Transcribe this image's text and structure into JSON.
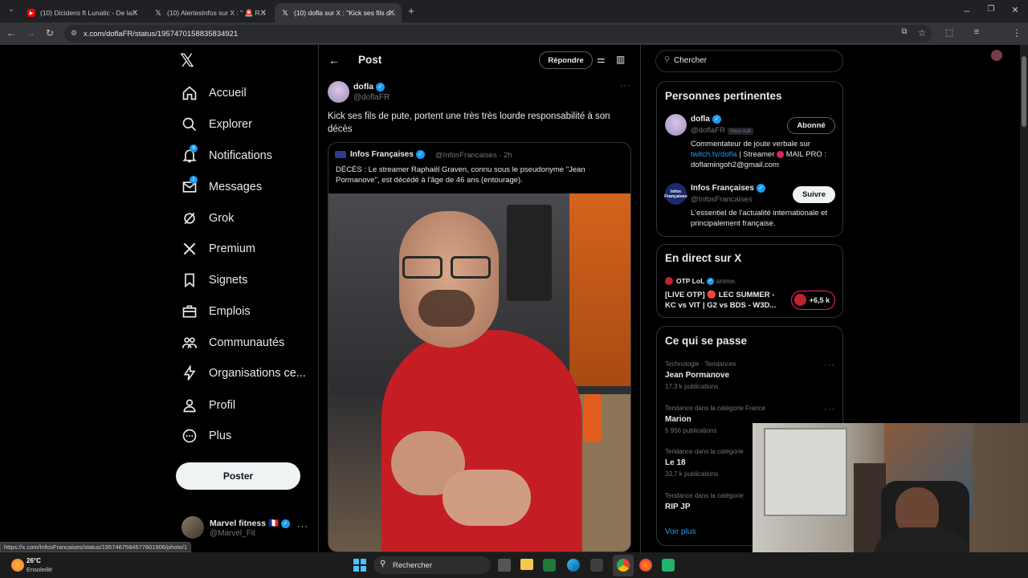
{
  "browser": {
    "tabs": [
      {
        "title": "(10) Dicidens ft Lunatic - De la...",
        "favicon": "youtube"
      },
      {
        "title": "(10) AlertesInfos sur X : \" 🚨 R...",
        "favicon": "x"
      },
      {
        "title": "(10) dofla sur X : \"Kick ses fils d...",
        "favicon": "x",
        "active": true
      }
    ],
    "url": "x.com/doflaFR/status/1957470158835834921",
    "status_url": "https://x.com/InfosFrancaises/status/1957467584577601906/photo/1"
  },
  "nav": {
    "items": [
      {
        "label": "Accueil",
        "icon": "home-icon"
      },
      {
        "label": "Explorer",
        "icon": "search-icon"
      },
      {
        "label": "Notifications",
        "icon": "bell-icon",
        "badge": "9"
      },
      {
        "label": "Messages",
        "icon": "mail-icon",
        "badge": "1"
      },
      {
        "label": "Grok",
        "icon": "grok-icon"
      },
      {
        "label": "Premium",
        "icon": "x-logo-icon"
      },
      {
        "label": "Signets",
        "icon": "bookmark-icon"
      },
      {
        "label": "Emplois",
        "icon": "briefcase-icon"
      },
      {
        "label": "Communautés",
        "icon": "people-icon"
      },
      {
        "label": "Organisations ce...",
        "icon": "lightning-icon"
      },
      {
        "label": "Profil",
        "icon": "person-icon"
      },
      {
        "label": "Plus",
        "icon": "more-circle-icon"
      }
    ],
    "post_button": "Poster",
    "account": {
      "name": "Marvel fitness 🇫🇷",
      "handle": "@Marvel_Fit"
    }
  },
  "post": {
    "header_title": "Post",
    "reply_button": "Répondre",
    "author_name": "dofla",
    "author_handle": "@doflaFR",
    "text": "Kick ses fils de pute, portent une très très lourde responsabilité à son décès",
    "quote": {
      "author_name": "Infos Françaises",
      "author_handle": "@InfosFrancaises",
      "time": "· 2h",
      "text": "DÉCÈS : Le streamer Raphaël Graven, connu sous le pseudonyme \"Jean Pormanove\", est décédé à l'âge de 46 ans (entourage)."
    }
  },
  "right": {
    "search_placeholder": "Chercher",
    "relevant": {
      "title": "Personnes pertinentes",
      "people": [
        {
          "name": "dofla",
          "handle": "@doflaFR",
          "follows_you": "Vous suit",
          "button": "Abonné",
          "bio": "Commentateur de joute verbale sur twitch.tv/dofla | Streamer 🔴 MAIL PRO : doflamingoh2@gmail.com"
        },
        {
          "name": "Infos Françaises",
          "handle": "@InfosFrancaises",
          "button": "Suivre",
          "bio": "L'essentiel de l'actualité internationale et principalement française."
        }
      ]
    },
    "live": {
      "title": "En direct sur X",
      "host": "OTP LoL",
      "host_status": "anime.",
      "text": "[LIVE OTP] 🔴 LEC SUMMER - KC vs VIT | G2 vs BDS - W3D...",
      "viewers": "+6,5 k"
    },
    "trends": {
      "title": "Ce qui se passe",
      "items": [
        {
          "meta": "Technologie · Tendances",
          "name": "Jean Pormanove",
          "count": "17,3 k publications"
        },
        {
          "meta": "Tendance dans la catégorie France",
          "name": "Marion",
          "count": "5 956 publications"
        },
        {
          "meta": "Tendance dans la catégorie",
          "name": "Le 18",
          "count": "33,7 k publications"
        },
        {
          "meta": "Tendance dans la catégorie",
          "name": "RIP JP",
          "count": ""
        }
      ],
      "more": "Voir plus"
    }
  },
  "taskbar": {
    "weather_temp": "26°C",
    "weather_text": "Ensoleillé",
    "search": "Rechercher"
  }
}
